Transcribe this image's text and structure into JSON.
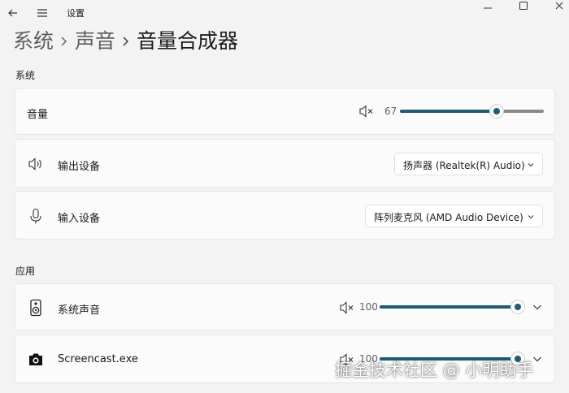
{
  "window": {
    "title": "设置"
  },
  "breadcrumb": {
    "items": [
      "系统",
      "声音"
    ],
    "current": "音量合成器"
  },
  "system_section": {
    "label": "系统",
    "volume": {
      "label": "音量",
      "value": "67",
      "level": 0.67,
      "icon": "speaker-muted-icon"
    },
    "output": {
      "label": "输出设备",
      "selected": "扬声器 (Realtek(R) Audio)",
      "icon": "speaker-icon"
    },
    "input": {
      "label": "输入设备",
      "selected": "阵列麦克风 (AMD Audio Device)",
      "icon": "microphone-icon"
    }
  },
  "apps_section": {
    "label": "应用",
    "apps": [
      {
        "name": "系统声音",
        "value": "100",
        "level": 1.0,
        "icon": "system-sounds-icon"
      },
      {
        "name": "Screencast.exe",
        "value": "100",
        "level": 1.0,
        "icon": "camera-icon"
      }
    ]
  },
  "colors": {
    "accent": "#1f5b73",
    "background": "#f3f3f3",
    "card": "#fbfbfb"
  },
  "watermark": "掘金技术社区 @ 小明助手"
}
